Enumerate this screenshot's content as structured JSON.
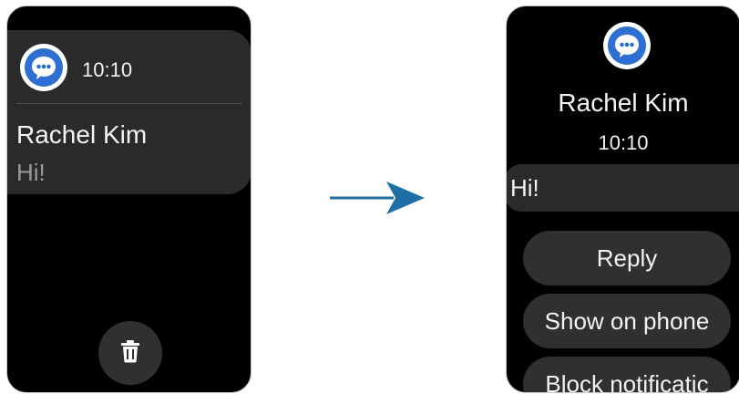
{
  "left_screen": {
    "time": "10:10",
    "sender": "Rachel Kim",
    "message": "Hi!"
  },
  "right_screen": {
    "sender": "Rachel Kim",
    "time": "10:10",
    "message": "Hi!",
    "actions": {
      "reply": "Reply",
      "show_on_phone": "Show on phone",
      "block": "Block notificatic"
    }
  },
  "icons": {
    "app": "chat-bubble-icon",
    "delete": "trash-icon",
    "transition": "arrow-right-icon"
  },
  "colors": {
    "app_icon_blue": "#2d6fd2",
    "arrow": "#1e6fa6",
    "card": "#2a2a2a",
    "button": "#303030"
  }
}
